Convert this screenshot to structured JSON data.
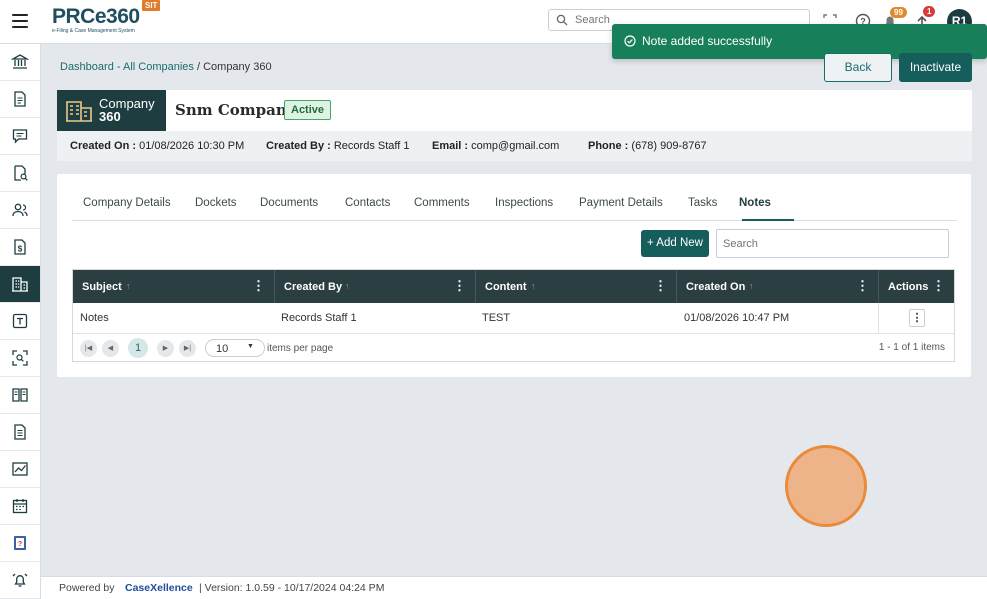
{
  "header": {
    "logo_text": "PRCe360",
    "logo_subtitle": "e-Filing & Case Management System",
    "env_badge": "SIT",
    "search_placeholder": "Search",
    "help_icon": "help-icon",
    "notifications_count": "99",
    "upload_count": "1",
    "avatar_initials": "R1"
  },
  "toast": {
    "message": "Note added successfully",
    "color": "#17805a"
  },
  "sidebar": {
    "items": [
      {
        "icon": "bank-icon"
      },
      {
        "icon": "document-icon"
      },
      {
        "icon": "comment-icon"
      },
      {
        "icon": "search-document-icon"
      },
      {
        "icon": "users-icon"
      },
      {
        "icon": "dollar-document-icon"
      },
      {
        "icon": "building-icon",
        "active": true
      },
      {
        "icon": "edit-square-icon"
      },
      {
        "icon": "scan-icon"
      },
      {
        "icon": "book-icon"
      },
      {
        "icon": "report-icon"
      },
      {
        "icon": "chart-icon"
      },
      {
        "icon": "calendar-icon"
      },
      {
        "icon": "help-book-icon"
      },
      {
        "icon": "alarm-icon"
      }
    ]
  },
  "breadcrumb": {
    "dashboard": "Dashboard",
    "sep1": " - ",
    "all_companies": "All Companies",
    "sep2": " / ",
    "current": "Company 360"
  },
  "actions": {
    "back": "Back",
    "inactivate": "Inactivate"
  },
  "company": {
    "tile_line1": "Company",
    "tile_line2": "360",
    "name": "Snm Company",
    "status": "Active"
  },
  "meta": {
    "created_on_label": "Created On :",
    "created_on": "01/08/2026 10:30 PM",
    "created_by_label": "Created By :",
    "created_by": "Records Staff 1",
    "email_label": "Email :",
    "email": "comp@gmail.com",
    "phone_label": "Phone :",
    "phone": "(678) 909-8767"
  },
  "tabs": [
    {
      "label": "Company Details"
    },
    {
      "label": "Dockets"
    },
    {
      "label": "Documents"
    },
    {
      "label": "Contacts"
    },
    {
      "label": "Comments"
    },
    {
      "label": "Inspections"
    },
    {
      "label": "Payment Details"
    },
    {
      "label": "Tasks"
    },
    {
      "label": "Notes",
      "active": true
    }
  ],
  "notes": {
    "add_new": "+ Add New",
    "search_placeholder": "Search",
    "columns": [
      "Subject",
      "Created By",
      "Content",
      "Created On",
      "Actions"
    ],
    "rows": [
      {
        "subject": "Notes",
        "created_by": "Records Staff 1",
        "content": "TEST",
        "created_on": "01/08/2026 10:47 PM"
      }
    ],
    "pager": {
      "current_page": "1",
      "page_size": "10",
      "per_page_text": "items per page",
      "count_text": "1 - 1 of 1 items"
    }
  },
  "footer": {
    "powered_by": "Powered by",
    "brand": "CaseXellence",
    "version": "|  Version: 1.0.59 - 10/17/2024 04:24 PM"
  }
}
